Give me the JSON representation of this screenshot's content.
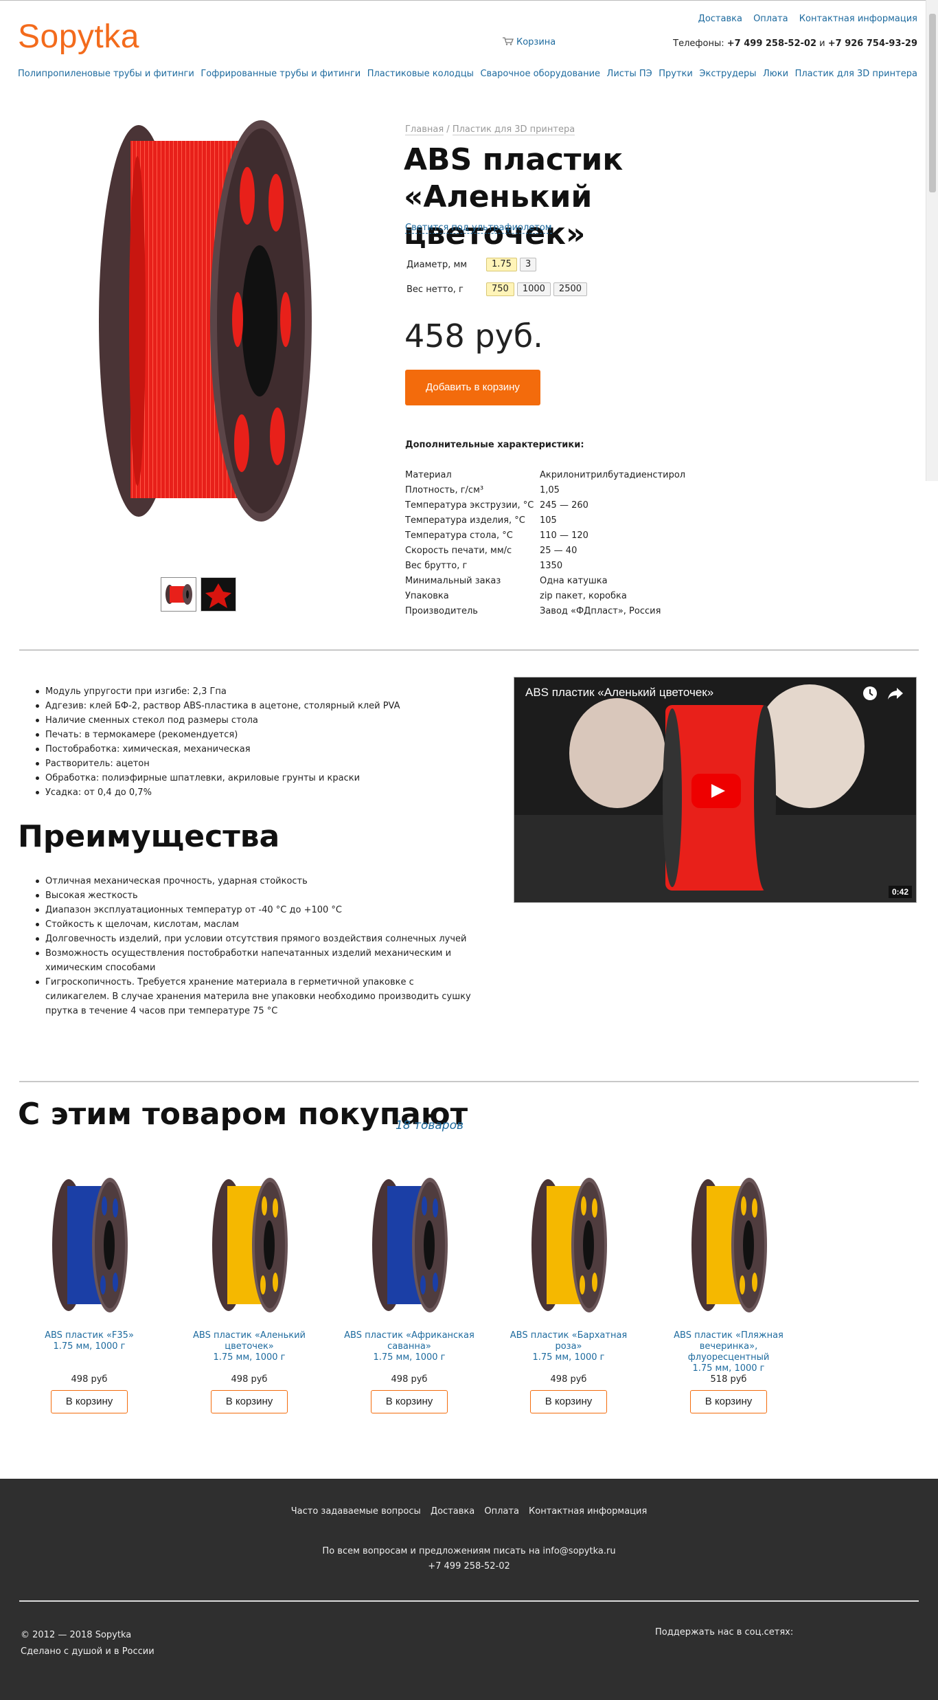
{
  "header": {
    "logo": "Sopytka",
    "cart": "Корзина",
    "top_links": [
      "Доставка",
      "Оплата",
      "Контактная информация"
    ],
    "phones_label": "Телефоны:",
    "phone1": "+7 499 258-52-02",
    "phones_sep": "и",
    "phone2": "+7 926 754-93-29"
  },
  "nav": [
    "Полипропиленовые трубы и фитинги",
    "Гофрированные трубы и фитинги",
    "Пластиковые колодцы",
    "Сварочное оборудование",
    "Листы ПЭ",
    "Прутки",
    "Экструдеры",
    "Люки",
    "Пластик для 3D принтера"
  ],
  "breadcrumb": {
    "home": "Главная",
    "sep": " / ",
    "category": "Пластик для 3D принтера"
  },
  "product": {
    "title_line1": "ABS пластик",
    "title_line2": "«Аленький цветочек»",
    "uv_link": "Светится под ультрафиолетом",
    "diameter_label": "Диаметр, мм",
    "diameter_options": [
      "1.75",
      "3"
    ],
    "diameter_selected": "1.75",
    "weight_label": "Вес нетто, г",
    "weight_options": [
      "750",
      "1000",
      "2500"
    ],
    "weight_selected": "750",
    "price": "458 руб.",
    "add_to_cart": "Добавить в корзину",
    "color": "#e8201a"
  },
  "specs_title": "Дополнительные характеристики:",
  "specs": [
    {
      "name": "Материал",
      "value": "Акрилонитрилбутадиенстирол"
    },
    {
      "name": "Плотность, г/см³",
      "value": "1,05"
    },
    {
      "name": "Температура экструзии, °С",
      "value": "245 — 260"
    },
    {
      "name": "Температура изделия, °С",
      "value": "105"
    },
    {
      "name": "Температура стола, °С",
      "value": "110 — 120"
    },
    {
      "name": "Скорость печати, мм/с",
      "value": "25 — 40"
    },
    {
      "name": "Вес брутто, г",
      "value": "1350"
    },
    {
      "name": "Минимальный заказ",
      "value": "Одна катушка"
    },
    {
      "name": "Упаковка",
      "value": "zip пакет, коробка"
    },
    {
      "name": "Производитель",
      "value": "Завод «ФДпласт», Россия"
    }
  ],
  "features": [
    "Модуль упругости при изгибе: 2,3 Гпа",
    "Адгезив: клей БФ-2, раствор ABS-пластика в ацетоне, столярный клей PVA",
    "Наличие сменных стекол под размеры стола",
    "Печать: в термокамере (рекомендуется)",
    "Постобработка: химическая, механическая",
    "Растворитель: ацетон",
    "Обработка: полиэфирные шпатлевки, акриловые грунты и краски",
    "Усадка: от 0,4 до 0,7%"
  ],
  "benefits_title": "Преимущества",
  "benefits": [
    "Отличная механическая прочность, ударная стойкость",
    "Высокая жесткость",
    "Диапазон эксплуатационных температур от -40 °С до +100 °С",
    "Стойкость к щелочам, кислотам, маслам",
    "Долговечность изделий, при условии отсутствия прямого воздействия солнечных лучей",
    "Возможность осуществления постобработки напечатанных изделий механическим и химическим способами",
    "Гигроскопичность. Требуется хранение материала в герметичной упаковке с силикагелем. В случае хранения материла вне упаковки необходимо производить сушку прутка в течение 4 часов при температуре 75 °С"
  ],
  "video": {
    "title": "ABS пластик «Аленький цветочек»",
    "duration": "0:42"
  },
  "related": {
    "title": "С этим товаром покупают",
    "count": "18 товаров",
    "button": "В корзину",
    "items": [
      {
        "name": "ABS пластик «F35»",
        "spec": "1.75 мм, 1000 г",
        "price": "498 руб",
        "color": "#1b3fa6"
      },
      {
        "name": "ABS пластик «Аленький цветочек»",
        "spec": "1.75 мм, 1000 г",
        "price": "498 руб",
        "color": "#f5b800"
      },
      {
        "name": "ABS пластик «Африканская саванна»",
        "spec": "1.75 мм, 1000 г",
        "price": "498 руб",
        "color": "#1b3fa6"
      },
      {
        "name": "ABS пластик «Бархатная роза»",
        "spec": "1.75 мм, 1000 г",
        "price": "498 руб",
        "color": "#f5b800"
      },
      {
        "name": "ABS пластик «Пляжная вечеринка», флуоресцентный",
        "spec": "1.75 мм, 1000 г",
        "price": "518 руб",
        "color": "#f5b800"
      }
    ]
  },
  "footer": {
    "links": [
      "Часто задаваемые вопросы",
      "Доставка",
      "Оплата",
      "Контактная информация"
    ],
    "mail_text": "По всем вопросам и предложениям писать на info@sopytka.ru",
    "phone": "+7 499 258-52-02",
    "copyright": "© 2012 — 2018 Sopytka",
    "made": "Сделано с душой и в России",
    "social": "Поддержать нас в соц.сетях:"
  },
  "colors": {
    "accent": "#f36b0c",
    "link": "#1d6a9e",
    "footer_bg": "#2f2f2f"
  }
}
